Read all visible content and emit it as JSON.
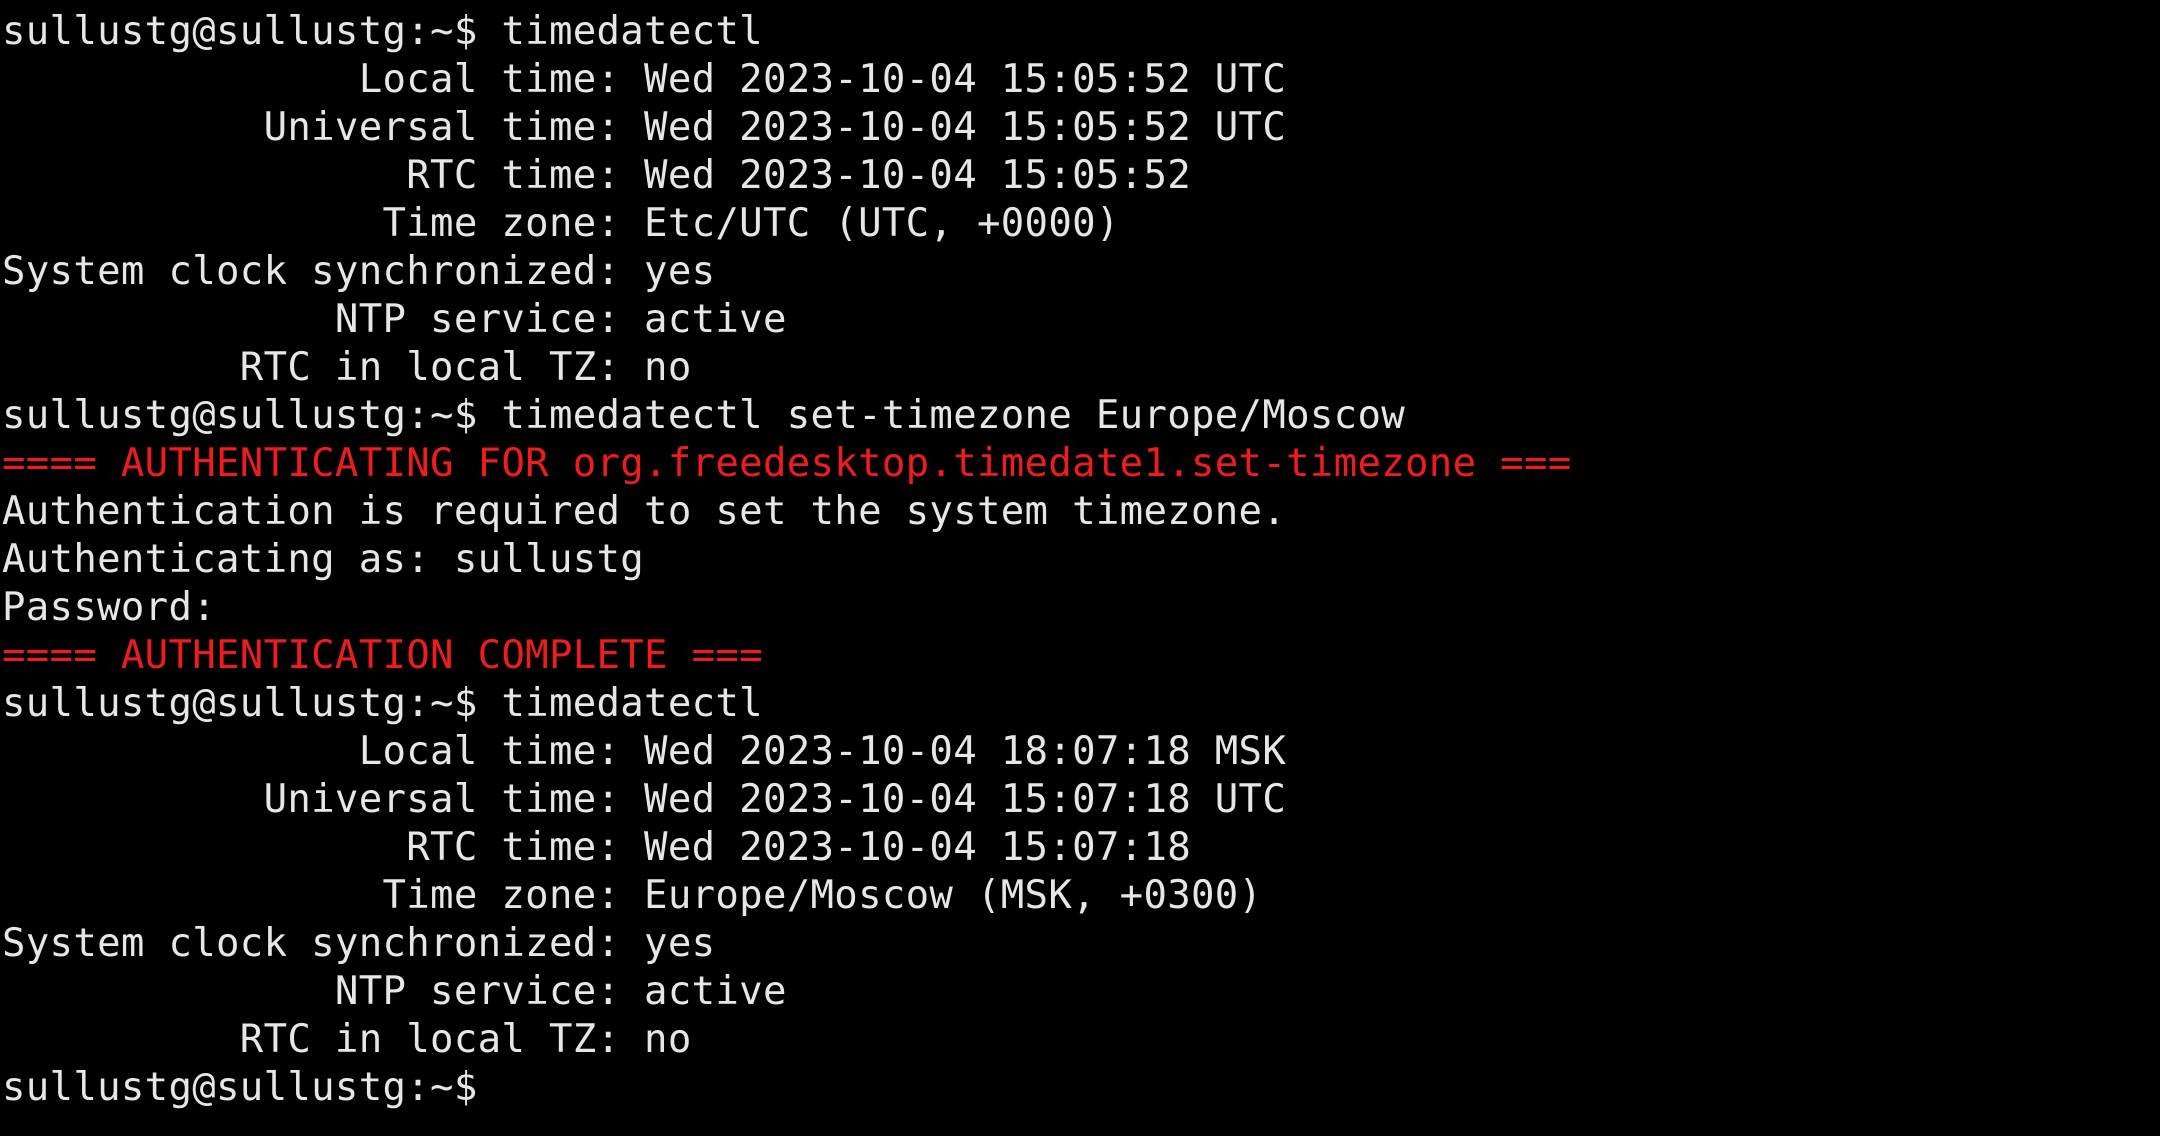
{
  "terminal": {
    "colors": {
      "background": "#000000",
      "text": "#e6e6e6",
      "auth_message": "#ee1c1c"
    },
    "lines": [
      {
        "text": "sullustg@sullustg:~$ timedatectl",
        "kind": "prompt"
      },
      {
        "text": "               Local time: Wed 2023-10-04 15:05:52 UTC",
        "kind": "output"
      },
      {
        "text": "           Universal time: Wed 2023-10-04 15:05:52 UTC",
        "kind": "output"
      },
      {
        "text": "                 RTC time: Wed 2023-10-04 15:05:52",
        "kind": "output"
      },
      {
        "text": "                Time zone: Etc/UTC (UTC, +0000)",
        "kind": "output"
      },
      {
        "text": "System clock synchronized: yes",
        "kind": "output"
      },
      {
        "text": "              NTP service: active",
        "kind": "output"
      },
      {
        "text": "          RTC in local TZ: no",
        "kind": "output"
      },
      {
        "text": "sullustg@sullustg:~$ timedatectl set-timezone Europe/Moscow",
        "kind": "prompt"
      },
      {
        "text": "==== AUTHENTICATING FOR org.freedesktop.timedate1.set-timezone ===",
        "kind": "auth"
      },
      {
        "text": "Authentication is required to set the system timezone.",
        "kind": "output"
      },
      {
        "text": "Authenticating as: sullustg",
        "kind": "output"
      },
      {
        "text": "Password:",
        "kind": "output"
      },
      {
        "text": "==== AUTHENTICATION COMPLETE ===",
        "kind": "auth"
      },
      {
        "text": "sullustg@sullustg:~$ timedatectl",
        "kind": "prompt"
      },
      {
        "text": "               Local time: Wed 2023-10-04 18:07:18 MSK",
        "kind": "output"
      },
      {
        "text": "           Universal time: Wed 2023-10-04 15:07:18 UTC",
        "kind": "output"
      },
      {
        "text": "                 RTC time: Wed 2023-10-04 15:07:18",
        "kind": "output"
      },
      {
        "text": "                Time zone: Europe/Moscow (MSK, +0300)",
        "kind": "output"
      },
      {
        "text": "System clock synchronized: yes",
        "kind": "output"
      },
      {
        "text": "              NTP service: active",
        "kind": "output"
      },
      {
        "text": "          RTC in local TZ: no",
        "kind": "output"
      },
      {
        "text": "sullustg@sullustg:~$ ",
        "kind": "prompt"
      }
    ]
  }
}
